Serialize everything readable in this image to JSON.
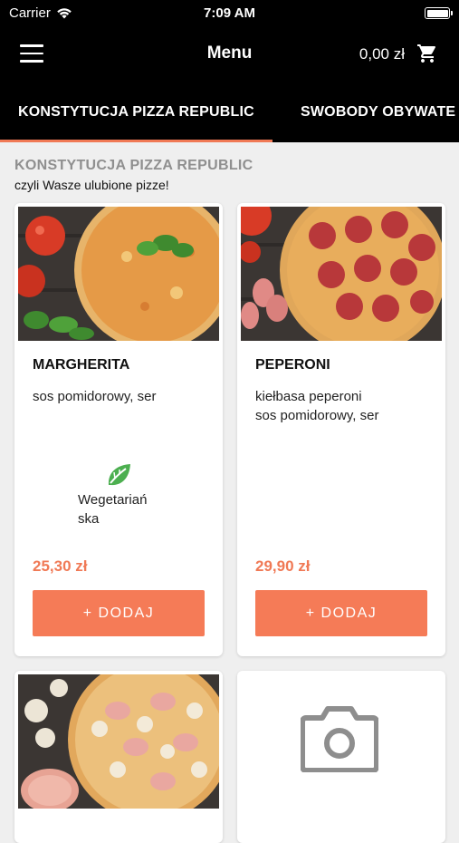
{
  "status_bar": {
    "carrier": "Carrier",
    "time": "7:09 AM"
  },
  "nav": {
    "title": "Menu",
    "cart_total": "0,00 zł",
    "menu_icon": "hamburger-icon",
    "cart_icon": "cart-icon"
  },
  "tabs": [
    {
      "label": "KONSTYTUCJA PIZZA REPUBLIC",
      "active": true
    },
    {
      "label": "SWOBODY OBYWATE",
      "active": false
    }
  ],
  "section": {
    "title": "KONSTYTUCJA PIZZA REPUBLIC",
    "subtitle": "czyli Wasze ulubione pizze!"
  },
  "products": [
    {
      "name": "MARGHERITA",
      "description": "sos pomidorowy, ser",
      "badge_label": "Wegetariań\nska",
      "badge_icon": "leaf-icon",
      "price": "25,30 zł",
      "button": "+ DODAJ"
    },
    {
      "name": "PEPERONI",
      "description_line1": "kiełbasa peperoni",
      "description_line2": "sos pomidorowy, ser",
      "price": "29,90 zł",
      "button": "+ DODAJ"
    },
    {
      "image": "pizza-mushroom-ham-photo"
    },
    {
      "image": "camera-placeholder-icon"
    }
  ],
  "colors": {
    "accent": "#f57b57",
    "price": "#f07955",
    "bar": "#000000",
    "background": "#efefef"
  }
}
